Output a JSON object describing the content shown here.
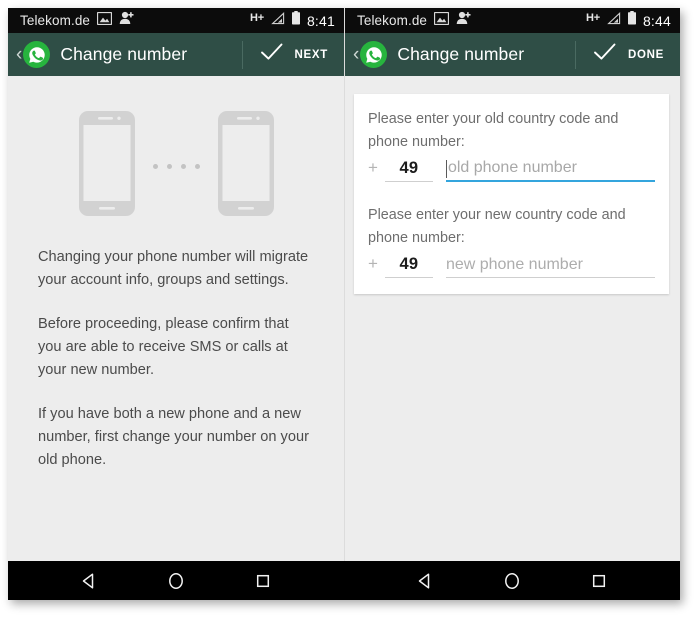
{
  "screens": [
    {
      "id": "left",
      "statusbar": {
        "carrier": "Telekom.de",
        "network": "H+",
        "time": "8:41",
        "icons": [
          "screenshot-icon",
          "person-add-icon",
          "signal-icon",
          "battery-icon"
        ]
      },
      "appbar": {
        "back_icon": "‹",
        "logo": "whatsapp-logo",
        "title": "Change number",
        "action_icon": "checkmark-icon",
        "action_label": "NEXT"
      },
      "illustration": {
        "name": "two-phones-transfer-illustration",
        "dots": 4
      },
      "paragraphs": [
        "Changing your phone number will migrate your account info, groups and settings.",
        "Before proceeding, please confirm that you are able to receive SMS or calls at your new number.",
        "If you have both a new phone and a new number, first change your number on your old phone."
      ]
    },
    {
      "id": "right",
      "statusbar": {
        "carrier": "Telekom.de",
        "network": "H+",
        "time": "8:44",
        "icons": [
          "screenshot-icon",
          "person-add-icon",
          "signal-icon",
          "battery-icon"
        ]
      },
      "appbar": {
        "back_icon": "‹",
        "logo": "whatsapp-logo",
        "title": "Change number",
        "action_icon": "checkmark-icon",
        "action_label": "DONE"
      },
      "form": {
        "fields": [
          {
            "label": "Please enter your old country code and phone number:",
            "plus": "+",
            "country_code": "49",
            "placeholder": "old phone number",
            "value": "",
            "focused": true
          },
          {
            "label": "Please enter your new country code and phone number:",
            "plus": "+",
            "country_code": "49",
            "placeholder": "new phone number",
            "value": "",
            "focused": false
          }
        ]
      }
    }
  ],
  "navbar": {
    "buttons": [
      "back-triangle-icon",
      "home-circle-icon",
      "recents-square-icon"
    ]
  },
  "colors": {
    "appbar_green": "#2f4e46",
    "whatsapp_green": "#27b43e",
    "focus_blue": "#34a5dd",
    "page_background": "#ededed",
    "statusbar_black": "#0c0c0c"
  }
}
